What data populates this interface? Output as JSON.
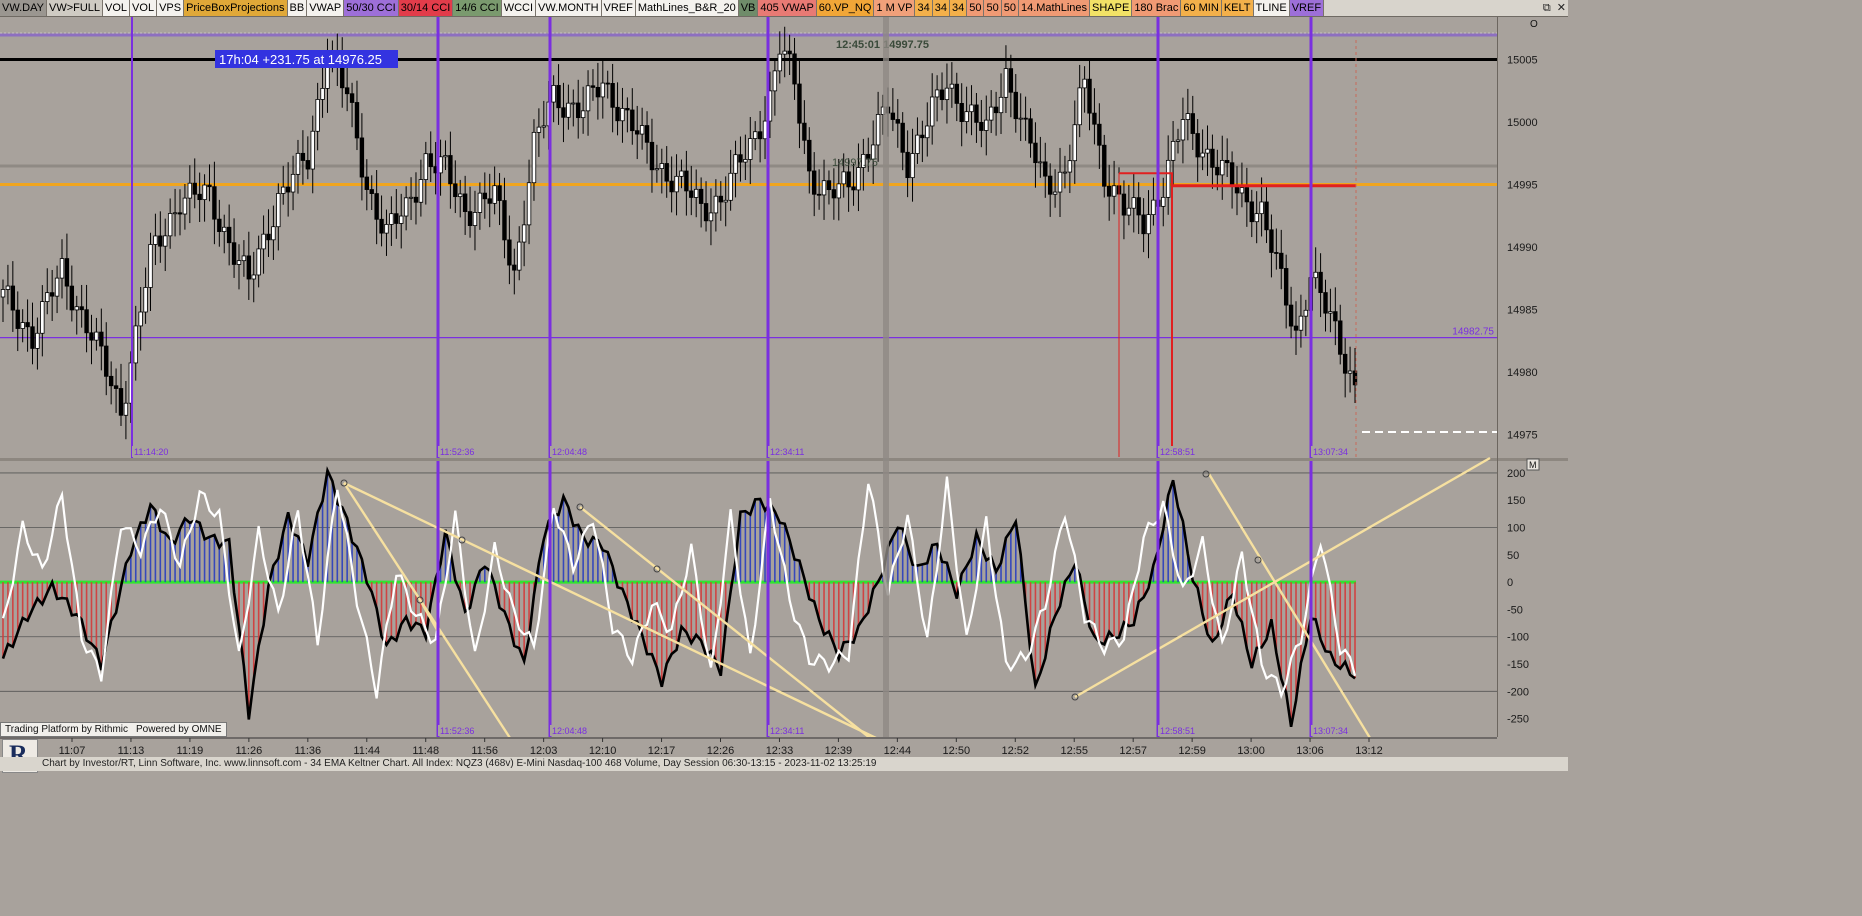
{
  "toolbar": [
    {
      "label": "VW.DAY",
      "bg": "#9a9690"
    },
    {
      "label": "VW>FULL",
      "bg": "#cfcbc3"
    },
    {
      "label": "VOL",
      "bg": "#f4f2ee"
    },
    {
      "label": "VOL",
      "bg": "#f4f2ee"
    },
    {
      "label": "VPS",
      "bg": "#f4f2ee"
    },
    {
      "label": "PriceBoxProjections",
      "bg": "#e0a838"
    },
    {
      "label": "BB",
      "bg": "#f4f2ee"
    },
    {
      "label": "VWAP",
      "bg": "#f4f2ee"
    },
    {
      "label": "50/30 CCI",
      "bg": "#9d6fd8"
    },
    {
      "label": "30/14 CCI",
      "bg": "#e23c4a"
    },
    {
      "label": "14/6 CCI",
      "bg": "#7a9a6e"
    },
    {
      "label": "WCCI",
      "bg": "#f4f2ee"
    },
    {
      "label": "VW.MONTH",
      "bg": "#f4f2ee"
    },
    {
      "label": "VREF",
      "bg": "#f4f2ee"
    },
    {
      "label": "MathLines_B&R_20",
      "bg": "#f4f2ee"
    },
    {
      "label": "VB",
      "bg": "#6f8c6a"
    },
    {
      "label": "405 VWAP",
      "bg": "#e87a74"
    },
    {
      "label": "60.VP_NQ",
      "bg": "#f1a637"
    },
    {
      "label": "1 M VP",
      "bg": "#f0a07a"
    },
    {
      "label": "34",
      "bg": "#f3b04a"
    },
    {
      "label": "34",
      "bg": "#f3b04a"
    },
    {
      "label": "34",
      "bg": "#f3b04a"
    },
    {
      "label": "50",
      "bg": "#f09a74"
    },
    {
      "label": "50",
      "bg": "#f09a74"
    },
    {
      "label": "50",
      "bg": "#f09a74"
    },
    {
      "label": "14.MathLines",
      "bg": "#f09a74"
    },
    {
      "label": "SHAPE",
      "bg": "#f2e266"
    },
    {
      "label": "180 Brac",
      "bg": "#f09a74"
    },
    {
      "label": "60 MIN",
      "bg": "#f3b04a"
    },
    {
      "label": "KELT",
      "bg": "#f3b04a"
    },
    {
      "label": "TLINE",
      "bg": "#f4f2ee"
    },
    {
      "label": "VREF",
      "bg": "#9d6fd8"
    }
  ],
  "window_controls": [
    "⧉",
    "✕"
  ],
  "colors": {
    "background": "#a8a29c",
    "purple": "#7a2fe0",
    "orange": "#f0a51e",
    "red": "#e02020",
    "cci_black": "#000000",
    "cci_white": "#ffffff",
    "zero_line": "#2fe52f",
    "trendline": "#f6e0a0",
    "tick_label": "#1a1a1a"
  },
  "info_box": "17h:04  +231.75 at 14976.25",
  "price_markers": [
    {
      "text": "12:45:01  14997.75",
      "color": "#3a4a3a"
    },
    {
      "text": "14997.75",
      "color": "#3a4a3a"
    }
  ],
  "purple_level_label": "14982.75",
  "price_axis": {
    "labels": [
      "15005",
      "15000",
      "14995",
      "14990",
      "14985",
      "14980",
      "14975"
    ],
    "values": [
      15005,
      15000,
      14995,
      14990,
      14985,
      14980,
      14975
    ],
    "range": [
      14973.2,
      15007.2
    ]
  },
  "cci_axis": {
    "labels": [
      "200",
      "150",
      "100",
      "50",
      "0",
      "-50",
      "-100",
      "-150",
      "-200",
      "-250"
    ],
    "values": [
      200,
      150,
      100,
      50,
      0,
      -50,
      -100,
      -150,
      -200,
      -250
    ],
    "range": [
      -280,
      220
    ]
  },
  "panel_tags": {
    "price": "O",
    "cci": "M"
  },
  "time_axis": {
    "labels": [
      "11:07",
      "11:13",
      "11:19",
      "11:26",
      "11:36",
      "11:44",
      "11:48",
      "11:56",
      "12:03",
      "12:10",
      "12:17",
      "12:26",
      "12:33",
      "12:39",
      "12:44",
      "12:50",
      "12:52",
      "12:55",
      "12:57",
      "12:59",
      "13:00",
      "13:06",
      "13:12"
    ]
  },
  "vline_labels_top": [
    "11:14:20",
    "11:52:36",
    "12:04:48",
    "12:34:11",
    "12:58:51",
    "13:07:34"
  ],
  "vline_labels_bottom": [
    "11:52:36",
    "12:04:48",
    "12:34:11",
    "12:58:51",
    "13:07:34"
  ],
  "brand": {
    "left": "Trading Platform by Rithmic",
    "right": "Powered by OMNE"
  },
  "logo_letter": "R",
  "footer": "Chart by Investor/RT, Linn Software, Inc. www.linnsoft.com - 34 EMA Keltner Chart. All Index: NQZ3 (468v) E-Mini Nasdaq-100 468 Volume, Day Session 06:30-13:15 - 2023-11-02 13:25:19",
  "chart_data": {
    "type": "candlestick",
    "title": "",
    "horizontal_levels": [
      {
        "value": 15005.0,
        "color": "#000000"
      },
      {
        "value": 14995.0,
        "color": "#f0a51e"
      },
      {
        "value": 14982.75,
        "color": "#7a2fe0"
      }
    ],
    "red_box_levels": [
      14995.9,
      14994.9
    ],
    "cci_reference_levels": [
      200,
      100,
      0,
      -100,
      -200
    ],
    "candle_anchors": [
      {
        "i": 0,
        "p": 14986
      },
      {
        "i": 6,
        "p": 14983
      },
      {
        "i": 12,
        "p": 14988
      },
      {
        "i": 18,
        "p": 14983
      },
      {
        "i": 24,
        "p": 14977
      },
      {
        "i": 30,
        "p": 14989
      },
      {
        "i": 36,
        "p": 14994
      },
      {
        "i": 42,
        "p": 14994
      },
      {
        "i": 50,
        "p": 14987
      },
      {
        "i": 56,
        "p": 14994
      },
      {
        "i": 62,
        "p": 14997
      },
      {
        "i": 66,
        "p": 15006
      },
      {
        "i": 70,
        "p": 15002
      },
      {
        "i": 74,
        "p": 14995
      },
      {
        "i": 78,
        "p": 14991
      },
      {
        "i": 82,
        "p": 14993
      },
      {
        "i": 86,
        "p": 14997
      },
      {
        "i": 90,
        "p": 14996
      },
      {
        "i": 94,
        "p": 14993
      },
      {
        "i": 100,
        "p": 14994
      },
      {
        "i": 104,
        "p": 14988
      },
      {
        "i": 108,
        "p": 14998
      },
      {
        "i": 112,
        "p": 15002
      },
      {
        "i": 118,
        "p": 15001
      },
      {
        "i": 122,
        "p": 15003
      },
      {
        "i": 126,
        "p": 15001
      },
      {
        "i": 132,
        "p": 14997
      },
      {
        "i": 138,
        "p": 14995
      },
      {
        "i": 142,
        "p": 14993
      },
      {
        "i": 146,
        "p": 14994
      },
      {
        "i": 152,
        "p": 14998
      },
      {
        "i": 156,
        "p": 15002
      },
      {
        "i": 158,
        "p": 15006
      },
      {
        "i": 161,
        "p": 15003
      },
      {
        "i": 164,
        "p": 14996
      },
      {
        "i": 168,
        "p": 14994
      },
      {
        "i": 172,
        "p": 14995
      },
      {
        "i": 176,
        "p": 14998
      },
      {
        "i": 180,
        "p": 15001
      },
      {
        "i": 184,
        "p": 14997
      },
      {
        "i": 188,
        "p": 15000
      },
      {
        "i": 192,
        "p": 15003
      },
      {
        "i": 196,
        "p": 15001
      },
      {
        "i": 200,
        "p": 14999
      },
      {
        "i": 204,
        "p": 15004
      },
      {
        "i": 208,
        "p": 14999
      },
      {
        "i": 212,
        "p": 14995
      },
      {
        "i": 216,
        "p": 14996
      },
      {
        "i": 220,
        "p": 15003
      },
      {
        "i": 224,
        "p": 14996
      },
      {
        "i": 228,
        "p": 14993
      },
      {
        "i": 232,
        "p": 14992
      },
      {
        "i": 236,
        "p": 14995
      },
      {
        "i": 240,
        "p": 15000
      },
      {
        "i": 244,
        "p": 14998
      },
      {
        "i": 248,
        "p": 14996
      },
      {
        "i": 252,
        "p": 14994
      },
      {
        "i": 256,
        "p": 14993
      },
      {
        "i": 260,
        "p": 14987
      },
      {
        "i": 263,
        "p": 14983
      },
      {
        "i": 266,
        "p": 14988
      },
      {
        "i": 269,
        "p": 14985
      },
      {
        "i": 272,
        "p": 14982
      },
      {
        "i": 275,
        "p": 14979
      }
    ],
    "candle_count": 276,
    "cci_black_anchors": [
      {
        "i": 0,
        "v": -140
      },
      {
        "i": 5,
        "v": -60
      },
      {
        "i": 10,
        "v": -10
      },
      {
        "i": 15,
        "v": -60
      },
      {
        "i": 20,
        "v": -150
      },
      {
        "i": 26,
        "v": 60
      },
      {
        "i": 30,
        "v": 140
      },
      {
        "i": 34,
        "v": 70
      },
      {
        "i": 38,
        "v": 120
      },
      {
        "i": 42,
        "v": 80
      },
      {
        "i": 46,
        "v": 70
      },
      {
        "i": 50,
        "v": -240
      },
      {
        "i": 54,
        "v": -10
      },
      {
        "i": 58,
        "v": 120
      },
      {
        "i": 62,
        "v": 40
      },
      {
        "i": 66,
        "v": 200
      },
      {
        "i": 70,
        "v": 110
      },
      {
        "i": 74,
        "v": 10
      },
      {
        "i": 78,
        "v": -120
      },
      {
        "i": 82,
        "v": -70
      },
      {
        "i": 86,
        "v": -90
      },
      {
        "i": 90,
        "v": 90
      },
      {
        "i": 94,
        "v": -60
      },
      {
        "i": 98,
        "v": 40
      },
      {
        "i": 102,
        "v": -60
      },
      {
        "i": 106,
        "v": -150
      },
      {
        "i": 110,
        "v": 90
      },
      {
        "i": 114,
        "v": 150
      },
      {
        "i": 118,
        "v": 80
      },
      {
        "i": 122,
        "v": 70
      },
      {
        "i": 126,
        "v": -20
      },
      {
        "i": 130,
        "v": -100
      },
      {
        "i": 134,
        "v": -180
      },
      {
        "i": 138,
        "v": -90
      },
      {
        "i": 142,
        "v": -110
      },
      {
        "i": 146,
        "v": -160
      },
      {
        "i": 150,
        "v": 120
      },
      {
        "i": 154,
        "v": 150
      },
      {
        "i": 158,
        "v": 120
      },
      {
        "i": 162,
        "v": 30
      },
      {
        "i": 166,
        "v": -70
      },
      {
        "i": 170,
        "v": -130
      },
      {
        "i": 174,
        "v": -90
      },
      {
        "i": 178,
        "v": 0
      },
      {
        "i": 182,
        "v": 110
      },
      {
        "i": 186,
        "v": 20
      },
      {
        "i": 190,
        "v": 70
      },
      {
        "i": 194,
        "v": -20
      },
      {
        "i": 198,
        "v": 80
      },
      {
        "i": 202,
        "v": 20
      },
      {
        "i": 206,
        "v": 120
      },
      {
        "i": 210,
        "v": -200
      },
      {
        "i": 214,
        "v": -60
      },
      {
        "i": 218,
        "v": 40
      },
      {
        "i": 222,
        "v": -110
      },
      {
        "i": 226,
        "v": -100
      },
      {
        "i": 230,
        "v": -70
      },
      {
        "i": 234,
        "v": 20
      },
      {
        "i": 238,
        "v": 190
      },
      {
        "i": 242,
        "v": 10
      },
      {
        "i": 246,
        "v": -120
      },
      {
        "i": 250,
        "v": -20
      },
      {
        "i": 254,
        "v": -150
      },
      {
        "i": 258,
        "v": -80
      },
      {
        "i": 262,
        "v": -260
      },
      {
        "i": 266,
        "v": -60
      },
      {
        "i": 270,
        "v": -140
      },
      {
        "i": 275,
        "v": -170
      }
    ],
    "cci_white_anchors": [
      {
        "i": 0,
        "v": -80
      },
      {
        "i": 4,
        "v": 100
      },
      {
        "i": 8,
        "v": 20
      },
      {
        "i": 12,
        "v": 160
      },
      {
        "i": 16,
        "v": -100
      },
      {
        "i": 20,
        "v": -170
      },
      {
        "i": 24,
        "v": 110
      },
      {
        "i": 28,
        "v": 60
      },
      {
        "i": 32,
        "v": 140
      },
      {
        "i": 36,
        "v": 30
      },
      {
        "i": 40,
        "v": 160
      },
      {
        "i": 44,
        "v": 120
      },
      {
        "i": 48,
        "v": -140
      },
      {
        "i": 52,
        "v": 90
      },
      {
        "i": 56,
        "v": -60
      },
      {
        "i": 60,
        "v": 130
      },
      {
        "i": 64,
        "v": -110
      },
      {
        "i": 68,
        "v": 180
      },
      {
        "i": 72,
        "v": -30
      },
      {
        "i": 76,
        "v": -200
      },
      {
        "i": 80,
        "v": 20
      },
      {
        "i": 84,
        "v": -60
      },
      {
        "i": 88,
        "v": -110
      },
      {
        "i": 92,
        "v": 120
      },
      {
        "i": 96,
        "v": -140
      },
      {
        "i": 100,
        "v": 60
      },
      {
        "i": 104,
        "v": -60
      },
      {
        "i": 108,
        "v": -120
      },
      {
        "i": 112,
        "v": 140
      },
      {
        "i": 116,
        "v": 30
      },
      {
        "i": 120,
        "v": 120
      },
      {
        "i": 124,
        "v": -80
      },
      {
        "i": 128,
        "v": -140
      },
      {
        "i": 132,
        "v": -40
      },
      {
        "i": 136,
        "v": -90
      },
      {
        "i": 140,
        "v": 60
      },
      {
        "i": 144,
        "v": -170
      },
      {
        "i": 148,
        "v": 120
      },
      {
        "i": 152,
        "v": -140
      },
      {
        "i": 156,
        "v": 150
      },
      {
        "i": 160,
        "v": -30
      },
      {
        "i": 164,
        "v": -140
      },
      {
        "i": 168,
        "v": -150
      },
      {
        "i": 172,
        "v": -130
      },
      {
        "i": 176,
        "v": 190
      },
      {
        "i": 180,
        "v": -20
      },
      {
        "i": 184,
        "v": 120
      },
      {
        "i": 188,
        "v": -110
      },
      {
        "i": 192,
        "v": 180
      },
      {
        "i": 196,
        "v": -110
      },
      {
        "i": 200,
        "v": 110
      },
      {
        "i": 204,
        "v": -150
      },
      {
        "i": 208,
        "v": -140
      },
      {
        "i": 212,
        "v": -40
      },
      {
        "i": 216,
        "v": 130
      },
      {
        "i": 220,
        "v": -60
      },
      {
        "i": 224,
        "v": -120
      },
      {
        "i": 228,
        "v": -100
      },
      {
        "i": 232,
        "v": 80
      },
      {
        "i": 236,
        "v": 140
      },
      {
        "i": 240,
        "v": -20
      },
      {
        "i": 244,
        "v": 70
      },
      {
        "i": 248,
        "v": -120
      },
      {
        "i": 252,
        "v": 50
      },
      {
        "i": 256,
        "v": -150
      },
      {
        "i": 260,
        "v": -200
      },
      {
        "i": 264,
        "v": -100
      },
      {
        "i": 268,
        "v": 80
      },
      {
        "i": 272,
        "v": -120
      },
      {
        "i": 275,
        "v": -160
      }
    ]
  }
}
